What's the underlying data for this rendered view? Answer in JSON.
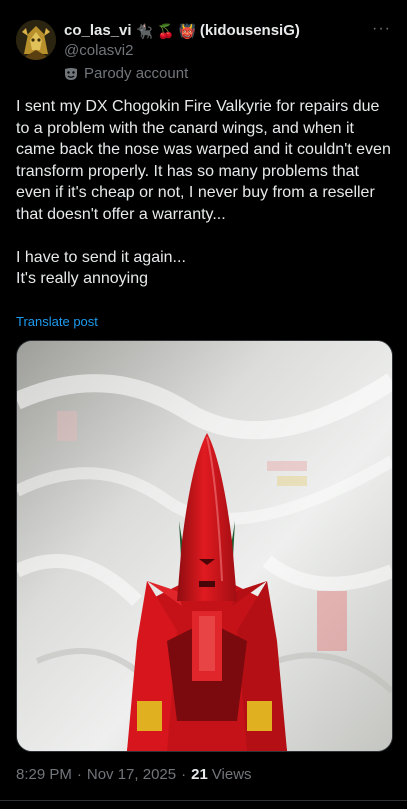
{
  "author": {
    "display_name": "co_las_vi",
    "display_name_suffix": "(kidousensiG)",
    "emojis": [
      "🐈‍⬛",
      "🍒",
      "👹"
    ],
    "handle": "@colasvi2",
    "label": "Parody account"
  },
  "more_label": "···",
  "post": {
    "paragraph1": "I sent my DX Chogokin Fire Valkyrie for repairs due to a problem with the canard wings, and when it came back the nose was warped and it couldn't even transform properly. It has so many problems that even if it's cheap or not, I never buy from a reseller that doesn't offer a warranty...",
    "line2": "I have to send it again...",
    "line3": "It's really annoying",
    "translate_label": "Translate post"
  },
  "meta": {
    "time": "8:29 PM",
    "date": "Nov 17, 2025",
    "views_count": "21",
    "views_label": "Views"
  },
  "colors": {
    "background": "#000000",
    "text": "#e7e9ea",
    "secondary": "#71767b",
    "link": "#1d9bf0",
    "figure_red": "#d4161c"
  }
}
